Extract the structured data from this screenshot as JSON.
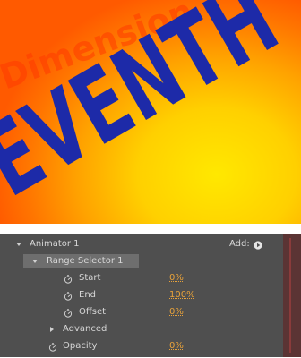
{
  "preview": {
    "text_main": "SEVENTH",
    "text_sub": "Dimension"
  },
  "panel": {
    "animator_label": "Animator 1",
    "add_label": "Add:",
    "range_selector_label": "Range Selector 1",
    "start_label": "Start",
    "start_value": "0%",
    "end_label": "End",
    "end_value": "100%",
    "offset_label": "Offset",
    "offset_value": "0%",
    "advanced_label": "Advanced",
    "opacity_label": "Opacity",
    "opacity_value": "0%"
  },
  "colors": {
    "main_text": "#1d2aa8",
    "sub_text": "#ff3b00",
    "value": "#e8a23a"
  },
  "icons": {
    "add": "add-play-icon",
    "stopwatch": "stopwatch-icon",
    "expand": "disclosure-triangle-icon"
  }
}
